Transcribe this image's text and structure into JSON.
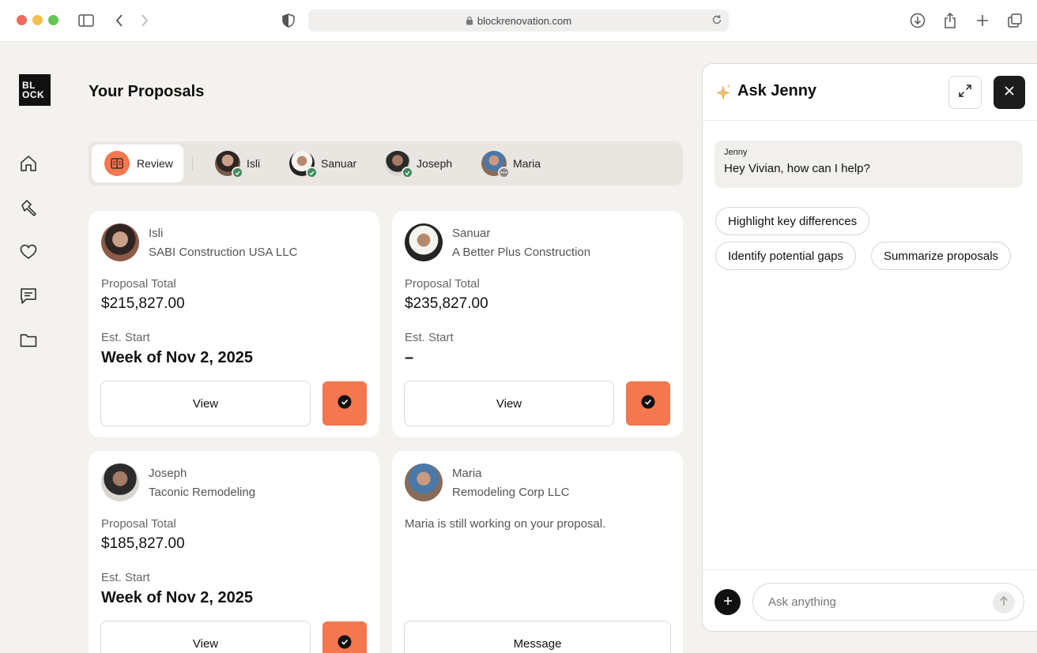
{
  "browser": {
    "url": "blockrenovation.com"
  },
  "brand": {
    "logo_line1": "BL",
    "logo_line2": "OCK"
  },
  "nav": {
    "items": [
      {
        "name": "home-icon"
      },
      {
        "name": "hammer-icon"
      },
      {
        "name": "heart-icon"
      },
      {
        "name": "chat-icon"
      },
      {
        "name": "folder-icon"
      }
    ]
  },
  "page": {
    "title": "Your Proposals"
  },
  "tabs": {
    "review_label": "Review",
    "contractors": [
      {
        "name": "Isli",
        "status": "accepted"
      },
      {
        "name": "Sanuar",
        "status": "accepted"
      },
      {
        "name": "Joseph",
        "status": "accepted"
      },
      {
        "name": "Maria",
        "status": "in-progress"
      }
    ]
  },
  "proposals": [
    {
      "name": "Isli",
      "company": "SABI Construction USA LLC",
      "total_label": "Proposal Total",
      "total": "$215,827.00",
      "start_label": "Est. Start",
      "start": "Week of Nov 2, 2025",
      "view_label": "View"
    },
    {
      "name": "Sanuar",
      "company": "A Better Plus Construction",
      "total_label": "Proposal Total",
      "total": "$235,827.00",
      "start_label": "Est. Start",
      "start": "–",
      "view_label": "View"
    },
    {
      "name": "Joseph",
      "company": "Taconic Remodeling",
      "total_label": "Proposal Total",
      "total": "$185,827.00",
      "start_label": "Est. Start",
      "start": "Week of Nov 2, 2025",
      "view_label": "View"
    },
    {
      "name": "Maria",
      "company": "Remodeling Corp LLC",
      "message": "Maria is still working on your proposal.",
      "message_label": "Message"
    }
  ],
  "assistant": {
    "title": "Ask Jenny",
    "sender": "Jenny",
    "greeting": "Hey Vivian, how can I help?",
    "suggestions": [
      "Highlight key differences",
      "Identify potential gaps",
      "Summarize proposals"
    ],
    "input_placeholder": "Ask anything"
  },
  "colors": {
    "accent": "#f4774f",
    "success": "#3f8a5b",
    "background": "#f4f2ef"
  }
}
